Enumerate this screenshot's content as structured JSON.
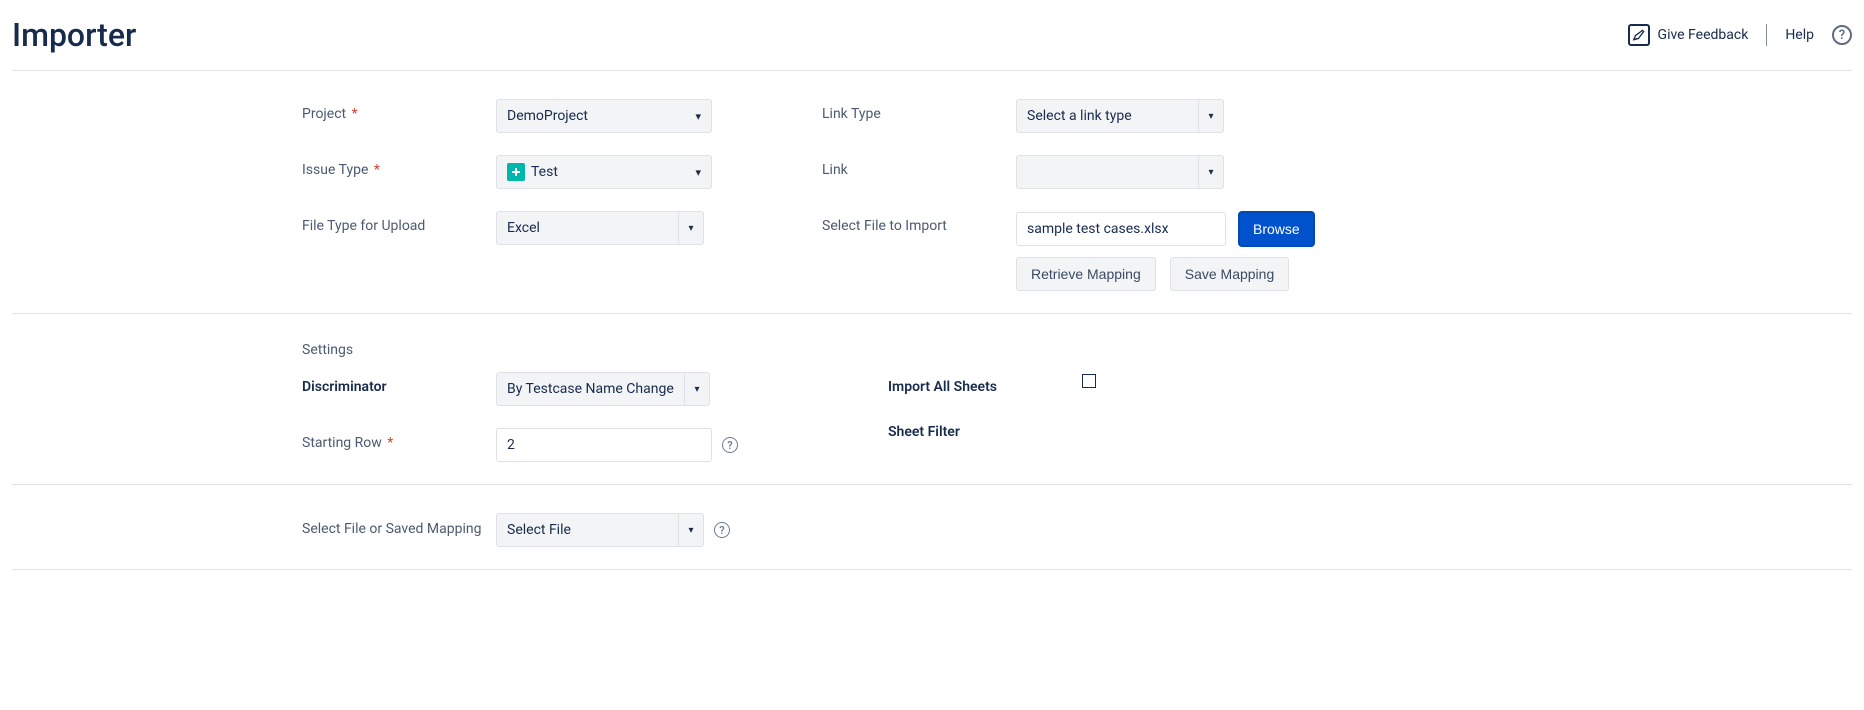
{
  "header": {
    "title": "Importer",
    "feedback_label": "Give Feedback",
    "help_label": "Help"
  },
  "form": {
    "project_label": "Project",
    "project_value": "DemoProject",
    "issue_type_label": "Issue Type",
    "issue_type_value": "Test",
    "file_type_label": "File Type for Upload",
    "file_type_value": "Excel",
    "link_type_label": "Link Type",
    "link_type_value": "Select a link type",
    "link_label": "Link",
    "link_value": "",
    "select_file_label": "Select File to Import",
    "select_file_value": "sample test cases.xlsx",
    "browse_label": "Browse",
    "retrieve_label": "Retrieve Mapping",
    "save_label": "Save Mapping"
  },
  "settings": {
    "title": "Settings",
    "discriminator_label": "Discriminator",
    "discriminator_value": "By Testcase Name Change",
    "starting_row_label": "Starting Row",
    "starting_row_value": "2",
    "import_all_label": "Import All Sheets",
    "sheet_filter_label": "Sheet Filter"
  },
  "mapping": {
    "select_mapping_label": "Select File or Saved Mapping",
    "select_mapping_value": "Select File"
  }
}
